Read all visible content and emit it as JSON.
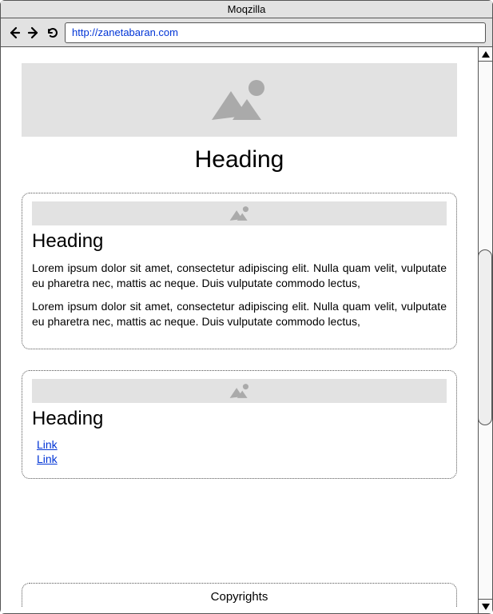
{
  "browser": {
    "title": "Moqzilla",
    "url": "http://zanetabaran.com"
  },
  "hero": {
    "heading": "Heading"
  },
  "cards": [
    {
      "heading": "Heading",
      "paragraphs": [
        "Lorem ipsum dolor sit amet, consectetur adipiscing elit. Nulla quam velit, vulputate eu pharetra nec, mattis ac neque. Duis vulputate commodo lectus,",
        "Lorem ipsum dolor sit amet, consectetur adipiscing elit. Nulla quam velit, vulputate eu pharetra nec, mattis ac neque. Duis vulputate commodo lectus,"
      ]
    },
    {
      "heading": "Heading",
      "links": [
        "Link",
        "Link"
      ]
    }
  ],
  "footer": {
    "text": "Copyrights"
  }
}
